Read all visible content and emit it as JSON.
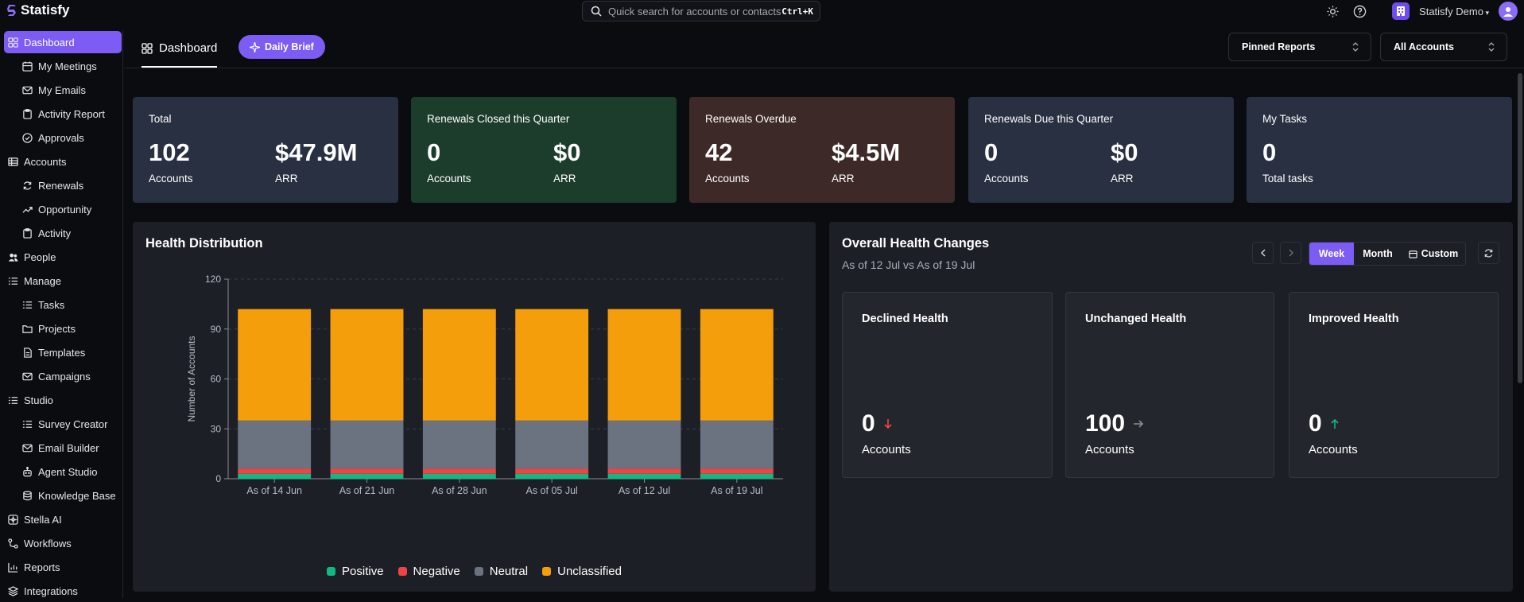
{
  "app": {
    "name": "Statisfy"
  },
  "search": {
    "placeholder": "Quick search for accounts or contacts",
    "shortcut": "Ctrl+K"
  },
  "topbar": {
    "org_name": "Statisfy Demo",
    "icons": [
      "sun-icon",
      "help-icon",
      "building-icon",
      "user-avatar-icon"
    ]
  },
  "sidebar": {
    "items": [
      {
        "label": "Dashboard",
        "icon": "grid-icon",
        "active": true
      },
      {
        "label": "My Meetings",
        "icon": "calendar-icon"
      },
      {
        "label": "My Emails",
        "icon": "mail-icon"
      },
      {
        "label": "Activity Report",
        "icon": "clipboard-icon"
      },
      {
        "label": "Approvals",
        "icon": "check-circle-icon"
      },
      {
        "label": "Accounts",
        "icon": "table-icon"
      },
      {
        "label": "Renewals",
        "icon": "refresh-icon"
      },
      {
        "label": "Opportunity",
        "icon": "trending-icon"
      },
      {
        "label": "Activity",
        "icon": "clipboard-icon"
      },
      {
        "label": "People",
        "icon": "users-icon"
      },
      {
        "label": "Manage",
        "icon": "list-icon"
      },
      {
        "label": "Tasks",
        "icon": "list-icon"
      },
      {
        "label": "Projects",
        "icon": "folder-icon"
      },
      {
        "label": "Templates",
        "icon": "file-icon"
      },
      {
        "label": "Campaigns",
        "icon": "mail-icon"
      },
      {
        "label": "Studio",
        "icon": "list-icon"
      },
      {
        "label": "Survey Creator",
        "icon": "list-icon"
      },
      {
        "label": "Email Builder",
        "icon": "mail-icon"
      },
      {
        "label": "Agent Studio",
        "icon": "bot-icon"
      },
      {
        "label": "Knowledge Base",
        "icon": "database-icon"
      },
      {
        "label": "Stella AI",
        "icon": "sparkle-box-icon"
      },
      {
        "label": "Workflows",
        "icon": "workflow-icon"
      },
      {
        "label": "Reports",
        "icon": "bar-chart-icon"
      },
      {
        "label": "Integrations",
        "icon": "layers-icon"
      }
    ]
  },
  "header": {
    "tab_label": "Dashboard",
    "daily_brief": "Daily Brief",
    "pinned_reports": "Pinned Reports",
    "accounts_filter": "All Accounts"
  },
  "kpis": [
    {
      "title": "Total",
      "v1": "102",
      "l1": "Accounts",
      "v2": "$47.9M",
      "l2": "ARR",
      "bg": "#283041"
    },
    {
      "title": "Renewals Closed this Quarter",
      "v1": "0",
      "l1": "Accounts",
      "v2": "$0",
      "l2": "ARR",
      "bg": "#1d3d2c"
    },
    {
      "title": "Renewals Overdue",
      "v1": "42",
      "l1": "Accounts",
      "v2": "$4.5M",
      "l2": "ARR",
      "bg": "#3d2a28"
    },
    {
      "title": "Renewals Due this Quarter",
      "v1": "0",
      "l1": "Accounts",
      "v2": "$0",
      "l2": "ARR",
      "bg": "#283041"
    },
    {
      "title": "My Tasks",
      "v1": "0",
      "l1": "Total tasks",
      "bg": "#283041"
    }
  ],
  "health_distribution": {
    "title": "Health Distribution"
  },
  "chart_data": {
    "type": "bar",
    "stacked": true,
    "title": "Health Distribution",
    "xlabel": "",
    "ylabel": "Number of Accounts",
    "ylim": [
      0,
      120
    ],
    "yticks": [
      0,
      30,
      60,
      90,
      120
    ],
    "grid": true,
    "legend_position": "bottom",
    "categories": [
      "As of 14 Jun",
      "As of 21 Jun",
      "As of 28 Jun",
      "As of 05 Jul",
      "As of 12 Jul",
      "As of 19 Jul"
    ],
    "series": [
      {
        "name": "Positive",
        "color": "#10b981",
        "values": [
          3,
          3,
          3,
          3,
          3,
          3
        ]
      },
      {
        "name": "Negative",
        "color": "#ef4444",
        "values": [
          3,
          3,
          3,
          3,
          3,
          3
        ]
      },
      {
        "name": "Neutral",
        "color": "#6b7280",
        "values": [
          29,
          29,
          29,
          29,
          29,
          29
        ]
      },
      {
        "name": "Unclassified",
        "color": "#f59e0b",
        "values": [
          67,
          67,
          67,
          67,
          67,
          67
        ]
      }
    ]
  },
  "health_changes": {
    "title": "Overall Health Changes",
    "subtitle": "As of 12 Jul vs As of 19 Jul",
    "periods": [
      "Week",
      "Month",
      "Custom"
    ],
    "active_period": "Week",
    "cards": [
      {
        "title": "Declined Health",
        "value": "0",
        "label": "Accounts",
        "arrow": "arrow-down-icon",
        "arrow_color": "#ef4444"
      },
      {
        "title": "Unchanged Health",
        "value": "100",
        "label": "Accounts",
        "arrow": "arrow-right-icon",
        "arrow_color": "#8a8e97"
      },
      {
        "title": "Improved Health",
        "value": "0",
        "label": "Accounts",
        "arrow": "arrow-up-icon",
        "arrow_color": "#10b981"
      }
    ]
  }
}
